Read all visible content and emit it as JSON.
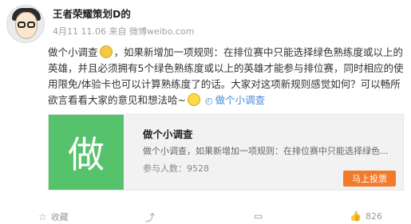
{
  "post": {
    "author": "王者荣耀策划D",
    "author_suffix": "的",
    "meta": "4月11 11.06 来自 微博weibo.com",
    "lines": [
      {
        "before": "做个小调查",
        "after": "，如果新增加一项规则：在排位赛中只能选择绿色熟练度或以上的"
      },
      {
        "text": "英雄，并且必须拥有5个绿色熟练度或以上的英雄才能参与排位赛，同时相应的使"
      },
      {
        "text": "用限免/体验卡也可以计算熟练度了的话。大家对这项新规则感觉如何？可以畅所"
      },
      {
        "before": "欲言看看大家的意见和想法哈~",
        "link": "做个小调查"
      }
    ]
  },
  "poll_card": {
    "thumb_char": "做",
    "title": "做个小调查",
    "desc": "做个小调查，如果新增加一项规则：在排位赛中只能选择绿色...",
    "count_label": "参与人数：",
    "count_value": "9528",
    "button": "马上投票"
  },
  "actions": {
    "share": "收藏",
    "forward": "",
    "comment": "",
    "like_count": "826"
  },
  "icons": {
    "avatar": "avatar-cartoon-glasses",
    "cat_emoji": "cat-face-emoji",
    "grin_emoji": "grinning-face-emoji",
    "poll": "poll-icon",
    "like": "thumbs-up-icon"
  },
  "colors": {
    "thumb_green": "#57c26c",
    "vote_orange": "#f47a2b",
    "link_blue": "#4a8ad6"
  }
}
